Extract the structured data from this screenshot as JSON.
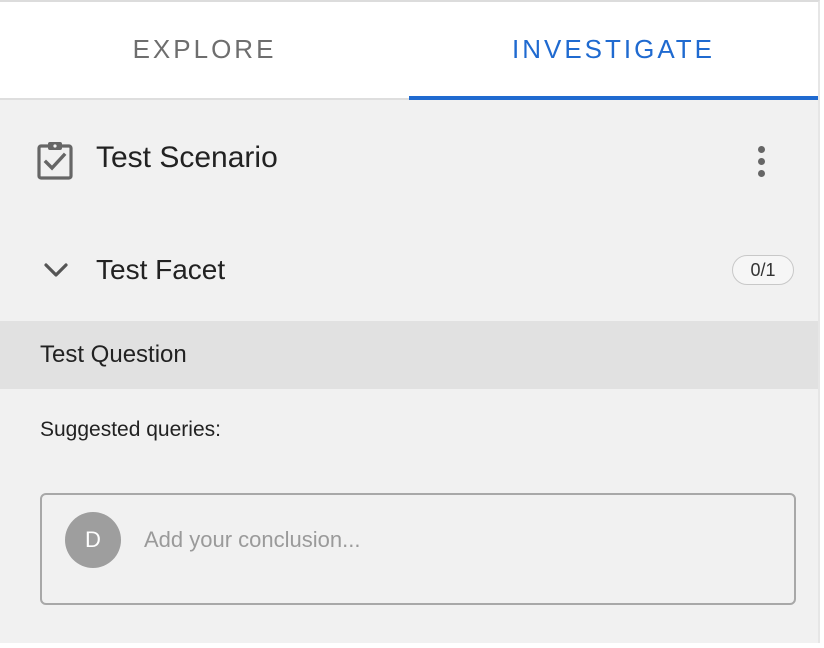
{
  "tabs": [
    {
      "label": "EXPLORE",
      "active": false
    },
    {
      "label": "INVESTIGATE",
      "active": true
    }
  ],
  "scenario": {
    "title": "Test Scenario",
    "icon": "clipboard-check-icon",
    "menu_icon": "more-vert-icon"
  },
  "facet": {
    "title": "Test Facet",
    "icon": "chevron-down-icon",
    "count": "0/1"
  },
  "question": {
    "text": "Test Question"
  },
  "suggested": {
    "label": "Suggested queries:"
  },
  "conclusion": {
    "avatar_initial": "D",
    "placeholder": "Add your conclusion...",
    "value": ""
  },
  "colors": {
    "accent": "#1f6ad0",
    "panel_bg": "#f1f1f1",
    "question_bg": "#e1e1e1",
    "avatar_bg": "#9e9e9e"
  }
}
